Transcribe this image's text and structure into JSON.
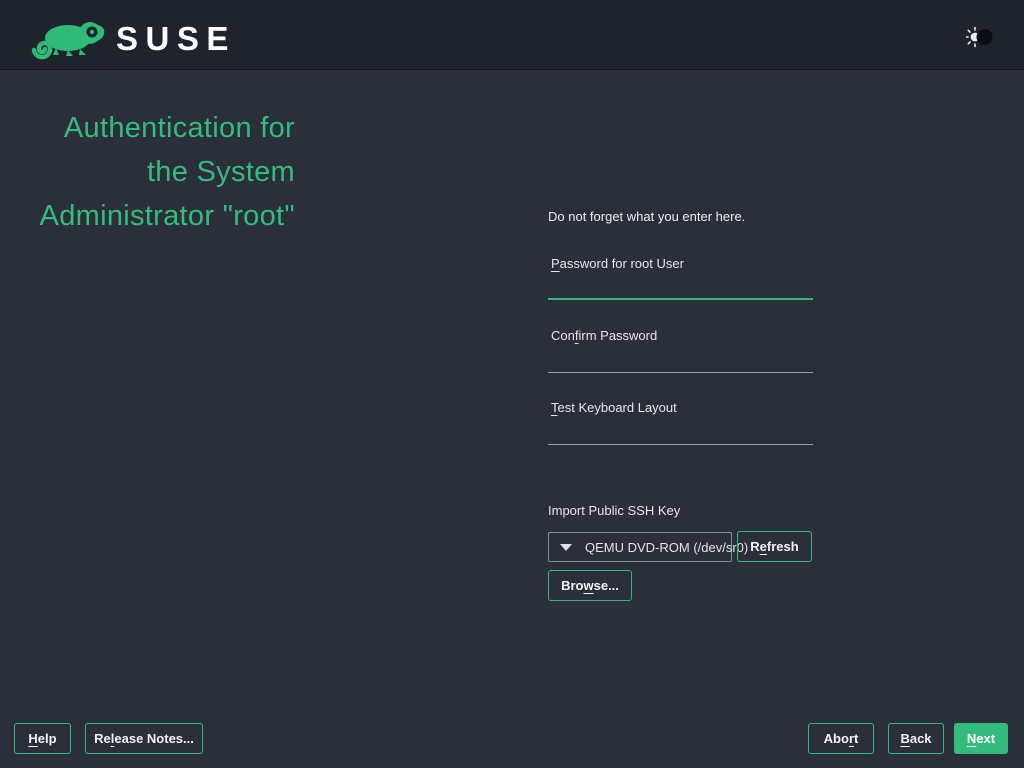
{
  "brand": {
    "name": "SUSE",
    "logo_icon": "chameleon-icon"
  },
  "header": {
    "theme_icon": "sun-moon-icon"
  },
  "title": {
    "full": "Authentication for the System Administrator \"root\"",
    "lines": [
      "Authentication for",
      "the System",
      "Administrator \"root\""
    ]
  },
  "form": {
    "hint": "Do not forget what you enter here.",
    "fields": [
      {
        "label": "&Password for root User",
        "value": "",
        "focused": true
      },
      {
        "label": "Con&firm Password",
        "value": "",
        "focused": false
      },
      {
        "label": "&Test Keyboard Layout",
        "value": "",
        "focused": false
      }
    ],
    "ssh": {
      "label": "Import Public SSH Key",
      "combo_value": "QEMU DVD-ROM (/dev/sr0)",
      "refresh_label": "R&efresh",
      "browse_label": "Bro&wse..."
    }
  },
  "footer": {
    "help_label": "&Help",
    "release_notes_label": "Re&lease Notes...",
    "abort_label": "Abo&rt",
    "back_label": "&Back",
    "next_label": "&Next"
  },
  "colors": {
    "accent_green": "#30ba78",
    "topbar": "#1f232c",
    "background": "#2b2f3a",
    "heading": "#34bc7d"
  }
}
